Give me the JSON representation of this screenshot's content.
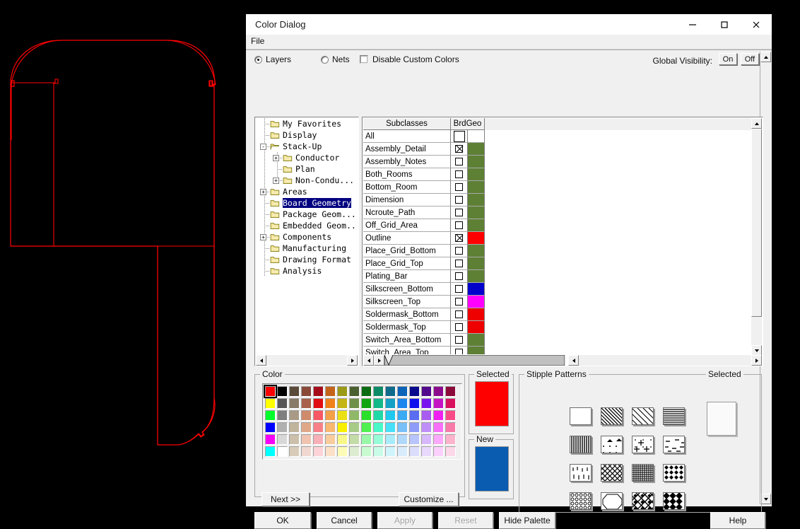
{
  "window": {
    "title": "Color Dialog",
    "minimize_label": "minimize",
    "maximize_label": "maximize",
    "close_label": "close",
    "menu": [
      "File"
    ]
  },
  "options": {
    "layers_label": "Layers",
    "layers_selected": true,
    "nets_label": "Nets",
    "nets_selected": false,
    "disable_custom_colors_label": "Disable Custom Colors",
    "disable_custom_colors_checked": false,
    "global_visibility_label": "Global Visibility:",
    "on_label": "On",
    "off_label": "Off"
  },
  "tree": {
    "items": [
      {
        "label": "My Favorites",
        "depth": 1,
        "expander": "",
        "selected": false
      },
      {
        "label": "Display",
        "depth": 1,
        "expander": "",
        "selected": false
      },
      {
        "label": "Stack-Up",
        "depth": 1,
        "expander": "-",
        "selected": false,
        "open": true
      },
      {
        "label": "Conductor",
        "depth": 2,
        "expander": "+",
        "selected": false
      },
      {
        "label": "Plan",
        "depth": 2,
        "expander": "",
        "selected": false
      },
      {
        "label": "Non-Condu...",
        "depth": 2,
        "expander": "+",
        "selected": false
      },
      {
        "label": "Areas",
        "depth": 1,
        "expander": "+",
        "selected": false
      },
      {
        "label": "Board Geometry",
        "depth": 1,
        "expander": "",
        "selected": true
      },
      {
        "label": "Package Geom...",
        "depth": 1,
        "expander": "",
        "selected": false
      },
      {
        "label": "Embedded Geom...",
        "depth": 1,
        "expander": "",
        "selected": false
      },
      {
        "label": "Components",
        "depth": 1,
        "expander": "+",
        "selected": false
      },
      {
        "label": "Manufacturing",
        "depth": 1,
        "expander": "",
        "selected": false
      },
      {
        "label": "Drawing Format",
        "depth": 1,
        "expander": "",
        "selected": false
      },
      {
        "label": "Analysis",
        "depth": 1,
        "expander": "",
        "selected": false
      }
    ]
  },
  "table": {
    "headers": [
      "Subclasses",
      "BrdGeo"
    ],
    "rows": [
      {
        "name": "All",
        "checked": false,
        "color": "#ffffff",
        "is_all": true
      },
      {
        "name": "Assembly_Detail",
        "checked": true,
        "color": "#5e8035"
      },
      {
        "name": "Assembly_Notes",
        "checked": false,
        "color": "#5e8035"
      },
      {
        "name": "Both_Rooms",
        "checked": false,
        "color": "#5e8035"
      },
      {
        "name": "Bottom_Room",
        "checked": false,
        "color": "#5e8035"
      },
      {
        "name": "Dimension",
        "checked": false,
        "color": "#5e8035"
      },
      {
        "name": "Ncroute_Path",
        "checked": false,
        "color": "#5e8035"
      },
      {
        "name": "Off_Grid_Area",
        "checked": false,
        "color": "#5e8035"
      },
      {
        "name": "Outline",
        "checked": true,
        "color": "#ff0000"
      },
      {
        "name": "Place_Grid_Bottom",
        "checked": false,
        "color": "#5e8035"
      },
      {
        "name": "Place_Grid_Top",
        "checked": false,
        "color": "#5e8035"
      },
      {
        "name": "Plating_Bar",
        "checked": false,
        "color": "#5e8035"
      },
      {
        "name": "Silkscreen_Bottom",
        "checked": false,
        "color": "#0000cc"
      },
      {
        "name": "Silkscreen_Top",
        "checked": false,
        "color": "#ff00ff"
      },
      {
        "name": "Soldermask_Bottom",
        "checked": false,
        "color": "#ee0000"
      },
      {
        "name": "Soldermask_Top",
        "checked": false,
        "color": "#ee0000"
      },
      {
        "name": "Switch_Area_Bottom",
        "checked": false,
        "color": "#5e8035"
      },
      {
        "name": "Switch_Area_Top",
        "checked": false,
        "color": "#5e8035"
      }
    ]
  },
  "color_group": {
    "caption": "Color",
    "next_label": "Next >>",
    "customize_label": "Customize ...",
    "selected_index": 0,
    "swatches": [
      "#ff0000",
      "#000000",
      "#5a4a3a",
      "#8a4a3a",
      "#a50d1a",
      "#c4641a",
      "#9a9a18",
      "#4a6030",
      "#0a6b12",
      "#0c8a66",
      "#106b8a",
      "#0c63b8",
      "#0a0a8c",
      "#520a8c",
      "#8c0a8c",
      "#8c0a3a",
      "#ffff00",
      "#565656",
      "#8a7a68",
      "#a8604a",
      "#e00d12",
      "#f08018",
      "#c4b414",
      "#6f9048",
      "#11a512",
      "#12b888",
      "#12a0c4",
      "#1a86ee",
      "#1010ee",
      "#7a14ee",
      "#c414c4",
      "#d8125e",
      "#00ff2a",
      "#7f7f7f",
      "#a89a86",
      "#d08a6c",
      "#f85864",
      "#f4a048",
      "#eae014",
      "#8fb868",
      "#2ae02a",
      "#22d8a8",
      "#20c8ee",
      "#3aaaf2",
      "#5a6cf0",
      "#a85cf0",
      "#f020f0",
      "#f84a86",
      "#0000ff",
      "#b0b0b0",
      "#c0b49c",
      "#e0a888",
      "#f88088",
      "#f8b870",
      "#f8f000",
      "#a8cc88",
      "#50f050",
      "#4af8c8",
      "#48e0f8",
      "#7ac0f8",
      "#8e9cf8",
      "#c08ef8",
      "#f870f8",
      "#f87aa8",
      "#f800f8",
      "#d8d8d8",
      "#ccc0ac",
      "#f0c4b0",
      "#f8b0b8",
      "#f8cc9c",
      "#f8f888",
      "#c4dca8",
      "#98f8a8",
      "#98fcd8",
      "#a8ecfc",
      "#b0d8fc",
      "#b8c4fc",
      "#d8b8fc",
      "#fca8fc",
      "#fcb4cc",
      "#00ffff",
      "#ffffff",
      "#d8ccb8",
      "#f0d8d0",
      "#fcd4d8",
      "#fce0c8",
      "#fcfcb8",
      "#dcecd0",
      "#c8fcd0",
      "#c8fce8",
      "#d0f4fc",
      "#d8ecfc",
      "#dcdcfc",
      "#e8d8fc",
      "#fcd0fc",
      "#fcd8e8"
    ]
  },
  "selected_group": {
    "caption": "Selected",
    "color": "#ff0000"
  },
  "new_group": {
    "caption": "New",
    "color": "#0a5cb0"
  },
  "stipple_group": {
    "caption": "Stipple Patterns",
    "patterns": [
      "solid-blank",
      "diagonal-lines-backslash",
      "diagonal-lines-wide",
      "horizontal-lines",
      "vertical-lines",
      "triangles-dots",
      "plus-dots",
      "dashes",
      "short-vertical-dashes",
      "crosshatch-diagonal",
      "fine-grid",
      "diamonds-dots",
      "small-circles",
      "octagon-outline",
      "diagonal-crosshatch-dots",
      "bold-diamonds"
    ]
  },
  "stipple_selected_group": {
    "caption": "Selected",
    "pattern": "none"
  },
  "footer": {
    "ok": "OK",
    "cancel": "Cancel",
    "apply": "Apply",
    "apply_disabled": true,
    "reset": "Reset",
    "reset_disabled": true,
    "hide_palette": "Hide Palette",
    "help": "Help"
  }
}
